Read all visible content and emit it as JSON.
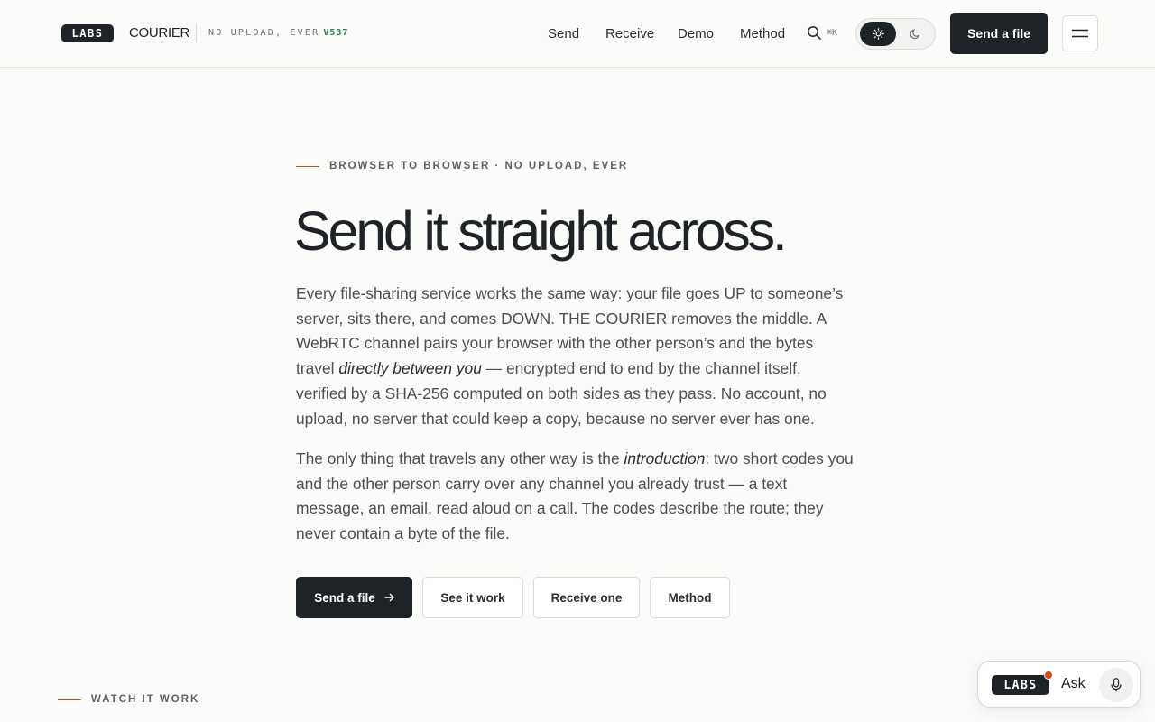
{
  "header": {
    "logo_text": "LABS",
    "brand": "COURIER",
    "tagline": "NO UPLOAD, EVER",
    "version": "V537",
    "nav": [
      "Send",
      "Receive",
      "Demo",
      "Method"
    ],
    "search_icon": "search-icon",
    "search_shortcut": "⌘K",
    "theme_options": [
      "sun-icon",
      "moon-icon"
    ],
    "theme_selected": "light",
    "cta_label": "Send a file",
    "menu_icon": "hamburger-icon"
  },
  "hero": {
    "eyebrow": "BROWSER TO BROWSER · NO UPLOAD, EVER",
    "headline": "Send it straight across.",
    "para1": {
      "before": "Every file-sharing service works the same way: your file goes UP to someone’s server, sits there, and comes DOWN. THE COURIER removes the middle. A WebRTC channel pairs your browser with the other person’s and the bytes travel ",
      "emphasis": "directly between you",
      "after": " — encrypted end to end by the channel itself, verified by a SHA-256 computed on both sides as they pass. No account, no upload, no server that could keep a copy, because no server ever has one."
    },
    "para2": {
      "before": "The only thing that travels any other way is the ",
      "emphasis": "introduction",
      "after": ": two short codes you and the other person carry over any channel you already trust — a text message, an email, read aloud on a call. The codes describe the route; they never contain a byte of the file."
    },
    "buttons": {
      "primary": "Send a file",
      "primary_icon": "arrow-right-icon",
      "see": "See it work",
      "receive": "Receive one",
      "method": "Method"
    }
  },
  "section": {
    "label": "WATCH IT WORK"
  },
  "ask_widget": {
    "logo_text": "LABS",
    "label": "Ask",
    "mic_icon": "microphone-icon"
  },
  "colors": {
    "ink": "#1d2326",
    "accent_rule": "#c2571f",
    "version_green": "#2f7a55",
    "notification_dot": "#d1491d",
    "background": "#fbfbfa"
  }
}
